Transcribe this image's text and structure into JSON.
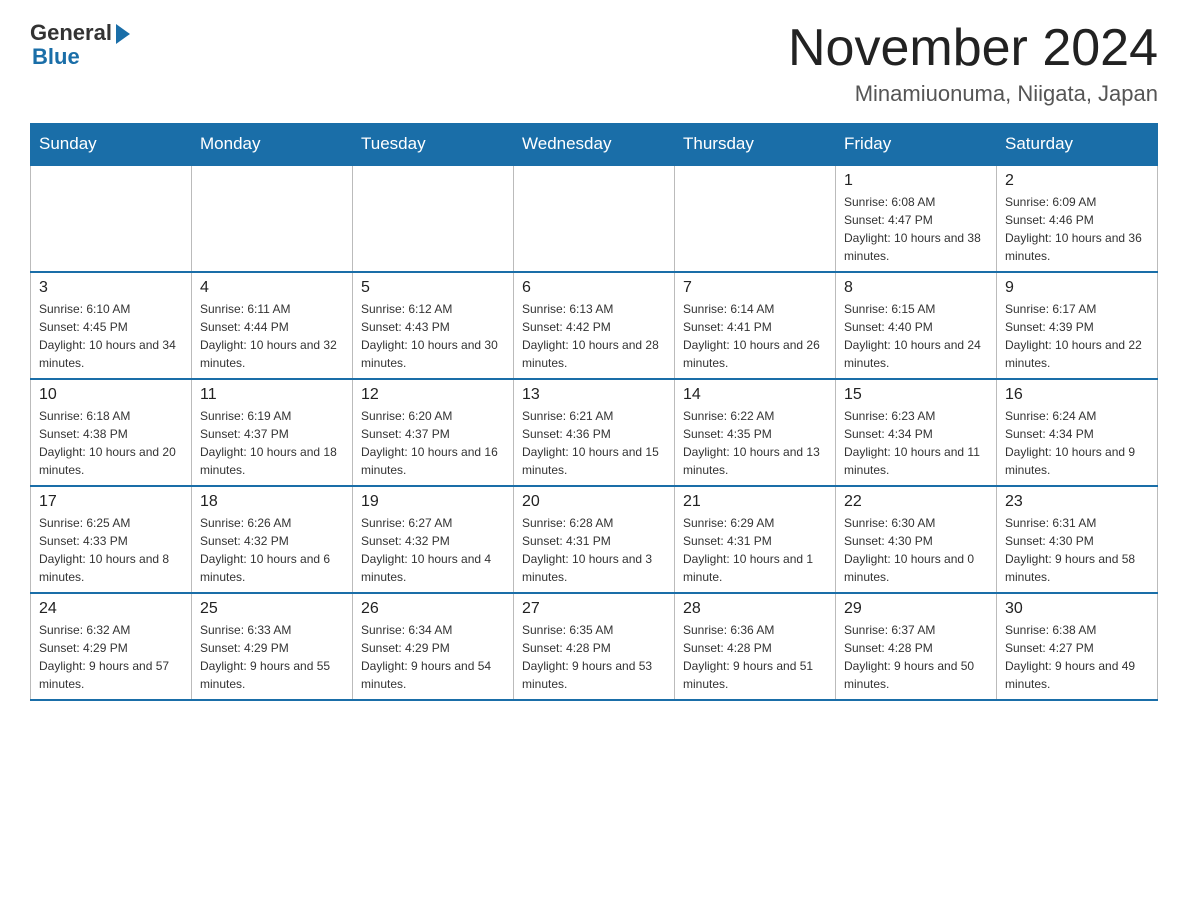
{
  "header": {
    "logo_general": "General",
    "logo_blue": "Blue",
    "month_title": "November 2024",
    "location": "Minamiuonuma, Niigata, Japan"
  },
  "weekdays": [
    "Sunday",
    "Monday",
    "Tuesday",
    "Wednesday",
    "Thursday",
    "Friday",
    "Saturday"
  ],
  "rows": [
    [
      {
        "day": "",
        "info": ""
      },
      {
        "day": "",
        "info": ""
      },
      {
        "day": "",
        "info": ""
      },
      {
        "day": "",
        "info": ""
      },
      {
        "day": "",
        "info": ""
      },
      {
        "day": "1",
        "info": "Sunrise: 6:08 AM\nSunset: 4:47 PM\nDaylight: 10 hours and 38 minutes."
      },
      {
        "day": "2",
        "info": "Sunrise: 6:09 AM\nSunset: 4:46 PM\nDaylight: 10 hours and 36 minutes."
      }
    ],
    [
      {
        "day": "3",
        "info": "Sunrise: 6:10 AM\nSunset: 4:45 PM\nDaylight: 10 hours and 34 minutes."
      },
      {
        "day": "4",
        "info": "Sunrise: 6:11 AM\nSunset: 4:44 PM\nDaylight: 10 hours and 32 minutes."
      },
      {
        "day": "5",
        "info": "Sunrise: 6:12 AM\nSunset: 4:43 PM\nDaylight: 10 hours and 30 minutes."
      },
      {
        "day": "6",
        "info": "Sunrise: 6:13 AM\nSunset: 4:42 PM\nDaylight: 10 hours and 28 minutes."
      },
      {
        "day": "7",
        "info": "Sunrise: 6:14 AM\nSunset: 4:41 PM\nDaylight: 10 hours and 26 minutes."
      },
      {
        "day": "8",
        "info": "Sunrise: 6:15 AM\nSunset: 4:40 PM\nDaylight: 10 hours and 24 minutes."
      },
      {
        "day": "9",
        "info": "Sunrise: 6:17 AM\nSunset: 4:39 PM\nDaylight: 10 hours and 22 minutes."
      }
    ],
    [
      {
        "day": "10",
        "info": "Sunrise: 6:18 AM\nSunset: 4:38 PM\nDaylight: 10 hours and 20 minutes."
      },
      {
        "day": "11",
        "info": "Sunrise: 6:19 AM\nSunset: 4:37 PM\nDaylight: 10 hours and 18 minutes."
      },
      {
        "day": "12",
        "info": "Sunrise: 6:20 AM\nSunset: 4:37 PM\nDaylight: 10 hours and 16 minutes."
      },
      {
        "day": "13",
        "info": "Sunrise: 6:21 AM\nSunset: 4:36 PM\nDaylight: 10 hours and 15 minutes."
      },
      {
        "day": "14",
        "info": "Sunrise: 6:22 AM\nSunset: 4:35 PM\nDaylight: 10 hours and 13 minutes."
      },
      {
        "day": "15",
        "info": "Sunrise: 6:23 AM\nSunset: 4:34 PM\nDaylight: 10 hours and 11 minutes."
      },
      {
        "day": "16",
        "info": "Sunrise: 6:24 AM\nSunset: 4:34 PM\nDaylight: 10 hours and 9 minutes."
      }
    ],
    [
      {
        "day": "17",
        "info": "Sunrise: 6:25 AM\nSunset: 4:33 PM\nDaylight: 10 hours and 8 minutes."
      },
      {
        "day": "18",
        "info": "Sunrise: 6:26 AM\nSunset: 4:32 PM\nDaylight: 10 hours and 6 minutes."
      },
      {
        "day": "19",
        "info": "Sunrise: 6:27 AM\nSunset: 4:32 PM\nDaylight: 10 hours and 4 minutes."
      },
      {
        "day": "20",
        "info": "Sunrise: 6:28 AM\nSunset: 4:31 PM\nDaylight: 10 hours and 3 minutes."
      },
      {
        "day": "21",
        "info": "Sunrise: 6:29 AM\nSunset: 4:31 PM\nDaylight: 10 hours and 1 minute."
      },
      {
        "day": "22",
        "info": "Sunrise: 6:30 AM\nSunset: 4:30 PM\nDaylight: 10 hours and 0 minutes."
      },
      {
        "day": "23",
        "info": "Sunrise: 6:31 AM\nSunset: 4:30 PM\nDaylight: 9 hours and 58 minutes."
      }
    ],
    [
      {
        "day": "24",
        "info": "Sunrise: 6:32 AM\nSunset: 4:29 PM\nDaylight: 9 hours and 57 minutes."
      },
      {
        "day": "25",
        "info": "Sunrise: 6:33 AM\nSunset: 4:29 PM\nDaylight: 9 hours and 55 minutes."
      },
      {
        "day": "26",
        "info": "Sunrise: 6:34 AM\nSunset: 4:29 PM\nDaylight: 9 hours and 54 minutes."
      },
      {
        "day": "27",
        "info": "Sunrise: 6:35 AM\nSunset: 4:28 PM\nDaylight: 9 hours and 53 minutes."
      },
      {
        "day": "28",
        "info": "Sunrise: 6:36 AM\nSunset: 4:28 PM\nDaylight: 9 hours and 51 minutes."
      },
      {
        "day": "29",
        "info": "Sunrise: 6:37 AM\nSunset: 4:28 PM\nDaylight: 9 hours and 50 minutes."
      },
      {
        "day": "30",
        "info": "Sunrise: 6:38 AM\nSunset: 4:27 PM\nDaylight: 9 hours and 49 minutes."
      }
    ]
  ]
}
